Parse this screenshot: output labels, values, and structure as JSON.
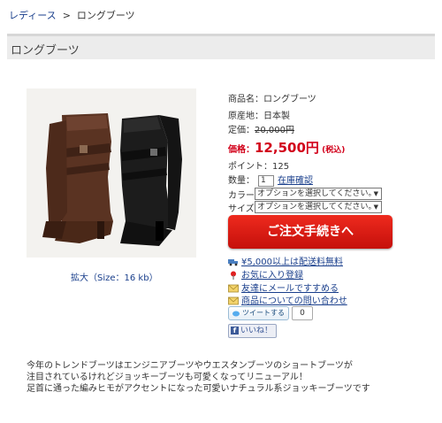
{
  "breadcrumb": {
    "parent": "レディース",
    "separator": ">",
    "current": "ロングブーツ"
  },
  "page_title": "ロングブーツ",
  "image": {
    "zoom_label": "拡大（Size：16 kb）"
  },
  "product": {
    "name_line": "商品名：ロングブーツ",
    "origin_line": "原産地：日本製",
    "list_price_label": "定価：",
    "list_price": "20,000円",
    "price_label": "価格：",
    "price": "12,500円",
    "tax_note": "(税込)",
    "points_line": "ポイント：125",
    "qty_label": "数量：",
    "qty_value": "1",
    "stock_link": "在庫確認",
    "color_label": "カラー",
    "color_select": "オプションを選択してください。",
    "size_label": "サイズ",
    "size_select": "オプションを選択してください。"
  },
  "order_button": "ご注文手続きへ",
  "links": {
    "shipping": "¥5,000以上は配送料無料",
    "favorite": "お気に入り登録",
    "recommend": "友達にメールですすめる",
    "inquiry": "商品についての問い合わせ"
  },
  "social": {
    "tweet": "ツイートする",
    "tweet_count": "0",
    "like": "いいね！"
  },
  "description": [
    "今年のトレンドブーツはエンジニアブーツやウエスタンブーツのショートブーツが",
    "注目されているけれどジョッキーブーツも可愛くなってリニューアル！",
    "足首に通った編みヒモがアクセントになった可愛いナチュラル系ジョッキーブーツです"
  ],
  "colors": {
    "link": "#1a3f8c",
    "price": "#d2001a",
    "order_button": "#e01e14"
  }
}
